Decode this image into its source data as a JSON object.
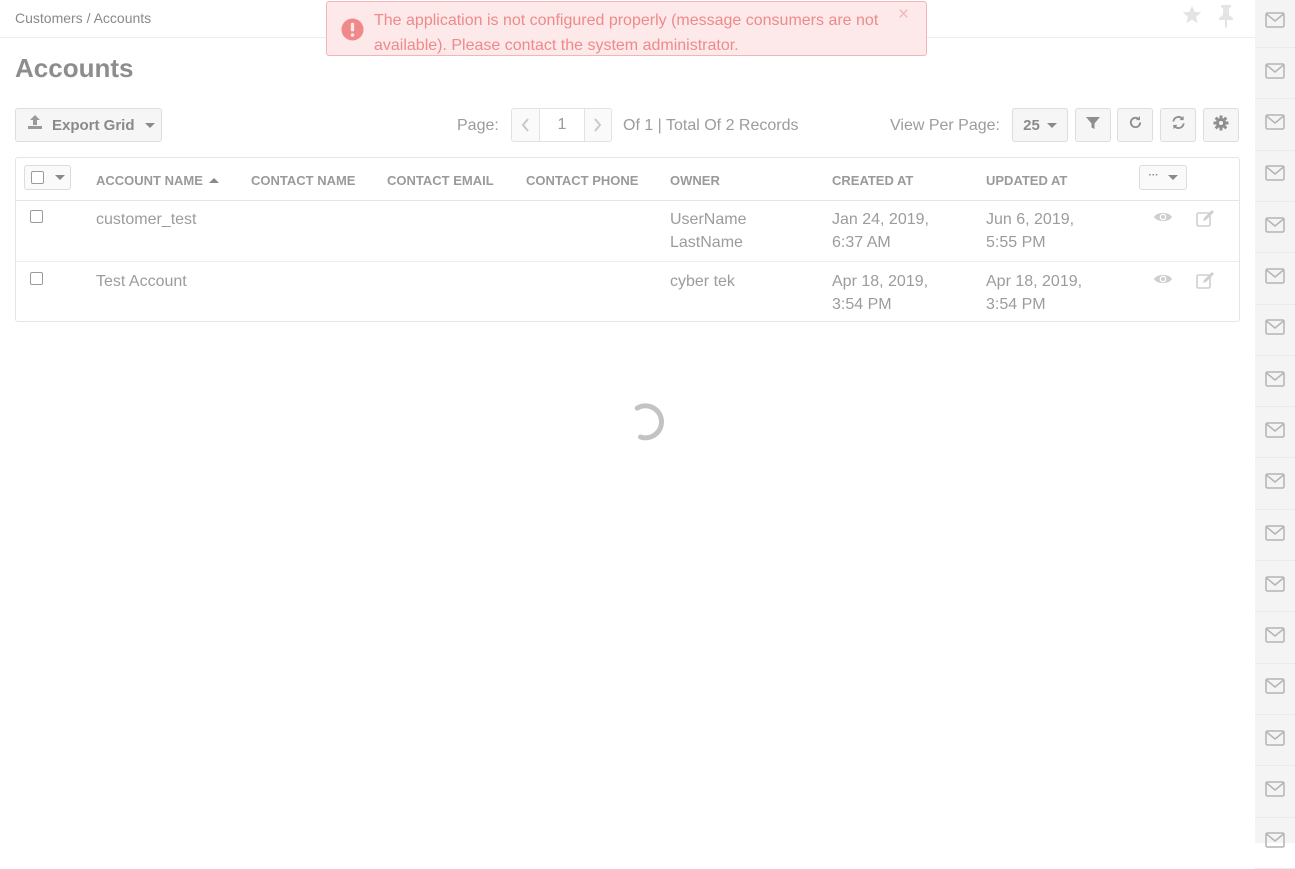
{
  "breadcrumb": {
    "parent": "Customers",
    "separator": "/",
    "current": "Accounts"
  },
  "page": {
    "title": "Accounts"
  },
  "alert": {
    "message": "The application is not configured properly (message consumers are not available). Please contact the system administrator.",
    "close_label": "×",
    "icon": "exclamation-circle-icon"
  },
  "toolbar": {
    "export_label": "Export Grid",
    "page_label": "Page:",
    "current_page": "1",
    "page_info": "Of 1 | Total Of 2 Records",
    "view_per_page_label": "View Per Page:",
    "view_per_page_value": "25"
  },
  "grid": {
    "columns": [
      "ACCOUNT NAME",
      "CONTACT NAME",
      "CONTACT EMAIL",
      "CONTACT PHONE",
      "OWNER",
      "CREATED AT",
      "UPDATED AT"
    ],
    "actions_label": "···",
    "rows": [
      {
        "account_name": "customer_test",
        "contact_name": "",
        "contact_email": "",
        "contact_phone": "",
        "owner_line1": "UserName",
        "owner_line2": "LastName",
        "created_line1": "Jan 24, 2019,",
        "created_line2": "6:37 AM",
        "updated_line1": "Jun 6, 2019,",
        "updated_line2": "5:55 PM"
      },
      {
        "account_name": "Test Account",
        "contact_name": "",
        "contact_email": "",
        "contact_phone": "",
        "owner_line1": "cyber tek",
        "owner_line2": "",
        "created_line1": "Apr 18, 2019,",
        "created_line2": "3:54 PM",
        "updated_line1": "Apr 18, 2019,",
        "updated_line2": "3:54 PM"
      }
    ]
  },
  "colors": {
    "alert_bg": "#fde9e9",
    "alert_text": "#ee8a8a",
    "text_muted": "#9c9c9c",
    "rail_bg": "#f4f4f4"
  },
  "icons": {
    "favorite": "star-icon",
    "pin": "pin-icon",
    "export": "upload-icon",
    "filter": "filter-icon",
    "reset": "reset-icon",
    "refresh": "refresh-icon",
    "settings": "gear-icon",
    "view": "eye-icon",
    "edit": "edit-icon",
    "rail": "envelope-icon",
    "loading": "spinner-icon"
  }
}
